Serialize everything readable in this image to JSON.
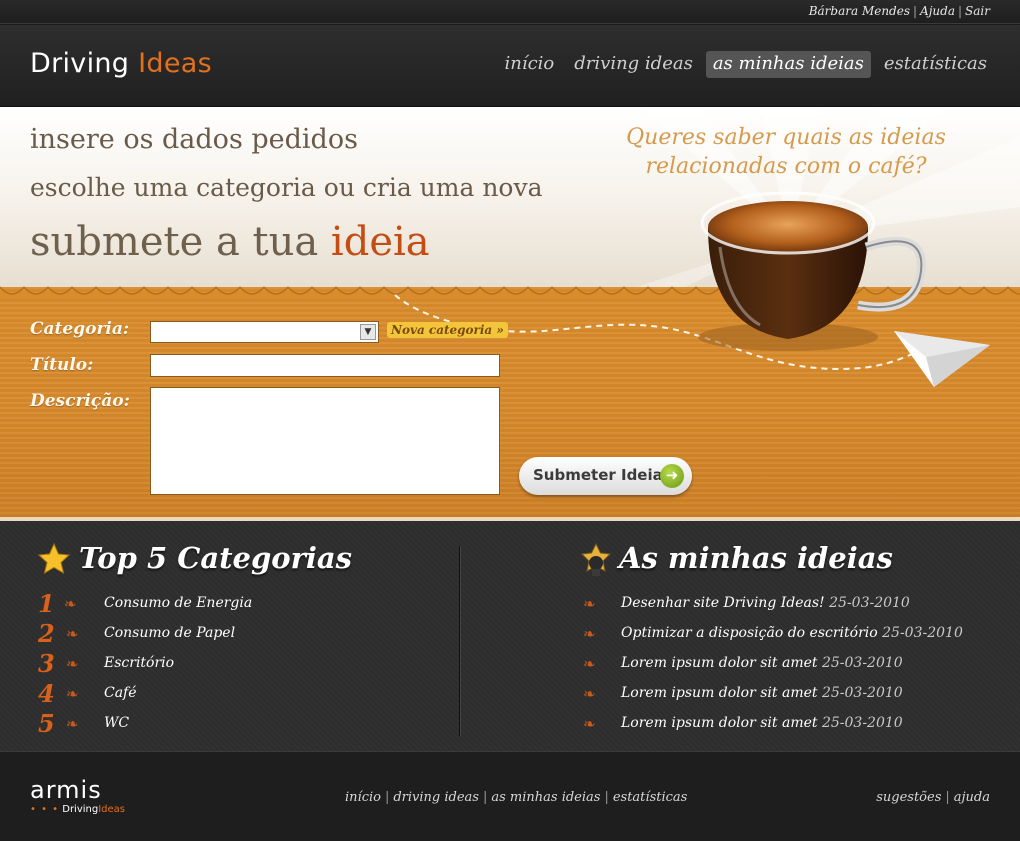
{
  "user_bar": {
    "user": "Bárbara Mendes",
    "help": "Ajuda",
    "logout": "Sair"
  },
  "brand": {
    "part1": "Driving",
    "part2": "Ideas"
  },
  "nav": [
    {
      "label": "início"
    },
    {
      "label": "driving ideas"
    },
    {
      "label": "as minhas ideias",
      "active": true
    },
    {
      "label": "estatísticas"
    }
  ],
  "hero": {
    "step1": "insere os dados pedidos",
    "step2": "escolhe uma categoria ou cria uma nova",
    "step3_prefix": "submete a tua",
    "step3_highlight": "ideia",
    "teaser_line1": "Queres saber quais as ideias",
    "teaser_line2": "relacionadas com o café?"
  },
  "form": {
    "category_label": "Categoria:",
    "category_value": "",
    "new_category_link": "Nova categoria »",
    "title_label": "Título:",
    "title_value": "",
    "description_label": "Descrição:",
    "description_value": "",
    "submit_label": "Submeter Ideia"
  },
  "top_categories": {
    "title": "Top 5 Categorias",
    "items": [
      {
        "rank": "1",
        "label": "Consumo de Energia"
      },
      {
        "rank": "2",
        "label": "Consumo de Papel"
      },
      {
        "rank": "3",
        "label": "Escritório"
      },
      {
        "rank": "4",
        "label": "Café"
      },
      {
        "rank": "5",
        "label": "WC"
      }
    ]
  },
  "my_ideas": {
    "title": "As minhas ideias",
    "items": [
      {
        "text": "Desenhar site Driving Ideas!",
        "date": "25-03-2010"
      },
      {
        "text": "Optimizar a disposição do escritório",
        "date": "25-03-2010"
      },
      {
        "text": "Lorem ipsum dolor sit amet",
        "date": "25-03-2010"
      },
      {
        "text": "Lorem ipsum dolor sit amet",
        "date": "25-03-2010"
      },
      {
        "text": "Lorem ipsum dolor sit amet",
        "date": "25-03-2010"
      }
    ]
  },
  "footer": {
    "logo_text": "armis",
    "logo_sub_dots": "• • •",
    "logo_sub_part1": "Driving",
    "logo_sub_part2": "Ideas",
    "nav": [
      "início",
      "driving ideas",
      "as minhas ideias",
      "estatísticas"
    ],
    "right": [
      "sugestões",
      "ajuda"
    ]
  },
  "icons": {
    "ornament": "❧",
    "star": "star-icon",
    "badge": "lightbulb-badge-icon",
    "cup": "coffee-cup-icon",
    "plane": "paper-plane-icon",
    "arrow": "arrow-right-icon"
  },
  "colors": {
    "accent": "#e2701c",
    "wood": "#d98c2c",
    "highlight": "#c44d14"
  }
}
